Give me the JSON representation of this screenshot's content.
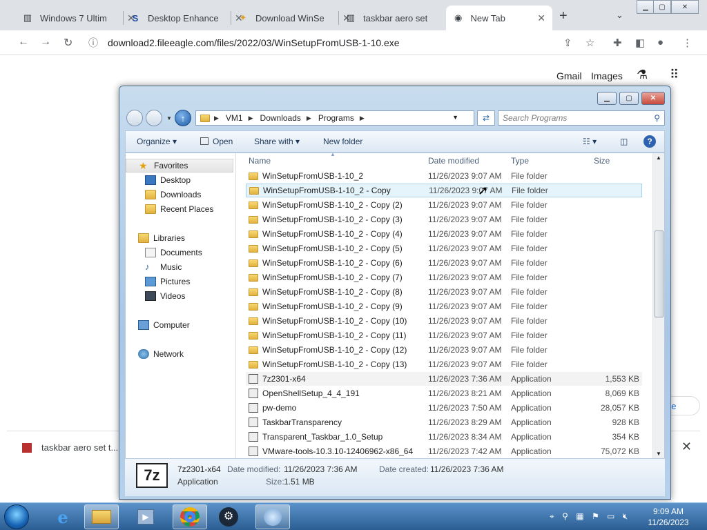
{
  "browser": {
    "tabs": [
      {
        "label": "Windows 7 Ultim",
        "icon": "site-icon"
      },
      {
        "label": "Desktop Enhance",
        "icon": "s-icon"
      },
      {
        "label": "Download WinSe",
        "icon": "download-icon"
      },
      {
        "label": "taskbar aero set",
        "icon": "site-icon"
      },
      {
        "label": "New Tab",
        "icon": "chrome-icon"
      }
    ],
    "url": "download2.fileeagle.com/files/2022/03/WinSetupFromUSB-1-10.exe",
    "google_links": {
      "gmail": "Gmail",
      "images": "Images"
    },
    "download_item": "taskbar aero set t...",
    "pill_text": "ne"
  },
  "explorer": {
    "breadcrumb": [
      "VM1",
      "Downloads",
      "Programs"
    ],
    "search_placeholder": "Search Programs",
    "commands": {
      "organize": "Organize",
      "open": "Open",
      "share": "Share with",
      "newfolder": "New folder"
    },
    "columns": {
      "name": "Name",
      "date": "Date modified",
      "type": "Type",
      "size": "Size"
    },
    "nav": {
      "favorites": "Favorites",
      "desktop": "Desktop",
      "downloads": "Downloads",
      "recent": "Recent Places",
      "libraries": "Libraries",
      "documents": "Documents",
      "music": "Music",
      "pictures": "Pictures",
      "videos": "Videos",
      "computer": "Computer",
      "network": "Network"
    },
    "rows": [
      {
        "name": "WinSetupFromUSB-1-10_2",
        "date": "11/26/2023 9:07 AM",
        "type": "File folder",
        "size": ""
      },
      {
        "name": "WinSetupFromUSB-1-10_2 - Copy",
        "date": "11/26/2023 9:07 AM",
        "type": "File folder",
        "size": ""
      },
      {
        "name": "WinSetupFromUSB-1-10_2 - Copy (2)",
        "date": "11/26/2023 9:07 AM",
        "type": "File folder",
        "size": ""
      },
      {
        "name": "WinSetupFromUSB-1-10_2 - Copy (3)",
        "date": "11/26/2023 9:07 AM",
        "type": "File folder",
        "size": ""
      },
      {
        "name": "WinSetupFromUSB-1-10_2 - Copy (4)",
        "date": "11/26/2023 9:07 AM",
        "type": "File folder",
        "size": ""
      },
      {
        "name": "WinSetupFromUSB-1-10_2 - Copy (5)",
        "date": "11/26/2023 9:07 AM",
        "type": "File folder",
        "size": ""
      },
      {
        "name": "WinSetupFromUSB-1-10_2 - Copy (6)",
        "date": "11/26/2023 9:07 AM",
        "type": "File folder",
        "size": ""
      },
      {
        "name": "WinSetupFromUSB-1-10_2 - Copy (7)",
        "date": "11/26/2023 9:07 AM",
        "type": "File folder",
        "size": ""
      },
      {
        "name": "WinSetupFromUSB-1-10_2 - Copy (8)",
        "date": "11/26/2023 9:07 AM",
        "type": "File folder",
        "size": ""
      },
      {
        "name": "WinSetupFromUSB-1-10_2 - Copy (9)",
        "date": "11/26/2023 9:07 AM",
        "type": "File folder",
        "size": ""
      },
      {
        "name": "WinSetupFromUSB-1-10_2 - Copy (10)",
        "date": "11/26/2023 9:07 AM",
        "type": "File folder",
        "size": ""
      },
      {
        "name": "WinSetupFromUSB-1-10_2 - Copy (11)",
        "date": "11/26/2023 9:07 AM",
        "type": "File folder",
        "size": ""
      },
      {
        "name": "WinSetupFromUSB-1-10_2 - Copy (12)",
        "date": "11/26/2023 9:07 AM",
        "type": "File folder",
        "size": ""
      },
      {
        "name": "WinSetupFromUSB-1-10_2 - Copy (13)",
        "date": "11/26/2023 9:07 AM",
        "type": "File folder",
        "size": ""
      },
      {
        "name": "7z2301-x64",
        "date": "11/26/2023 7:36 AM",
        "type": "Application",
        "size": "1,553 KB"
      },
      {
        "name": "OpenShellSetup_4_4_191",
        "date": "11/26/2023 8:21 AM",
        "type": "Application",
        "size": "8,069 KB"
      },
      {
        "name": "pw-demo",
        "date": "11/26/2023 7:50 AM",
        "type": "Application",
        "size": "28,057 KB"
      },
      {
        "name": "TaskbarTransparency",
        "date": "11/26/2023 8:29 AM",
        "type": "Application",
        "size": "928 KB"
      },
      {
        "name": "Transparent_Taskbar_1.0_Setup",
        "date": "11/26/2023 8:34 AM",
        "type": "Application",
        "size": "354 KB"
      },
      {
        "name": "VMware-tools-10.3.10-12406962-x86_64",
        "date": "11/26/2023 7:42 AM",
        "type": "Application",
        "size": "75,072 KB"
      }
    ],
    "details": {
      "name": "7z2301-x64",
      "type": "Application",
      "date_modified_label": "Date modified:",
      "date_modified": "11/26/2023 7:36 AM",
      "date_created_label": "Date created:",
      "date_created": "11/26/2023 7:36 AM",
      "size_label": "Size:",
      "size": "1.51 MB",
      "icon_text": "7z"
    }
  },
  "taskbar": {
    "time": "9:09 AM",
    "date": "11/26/2023"
  }
}
